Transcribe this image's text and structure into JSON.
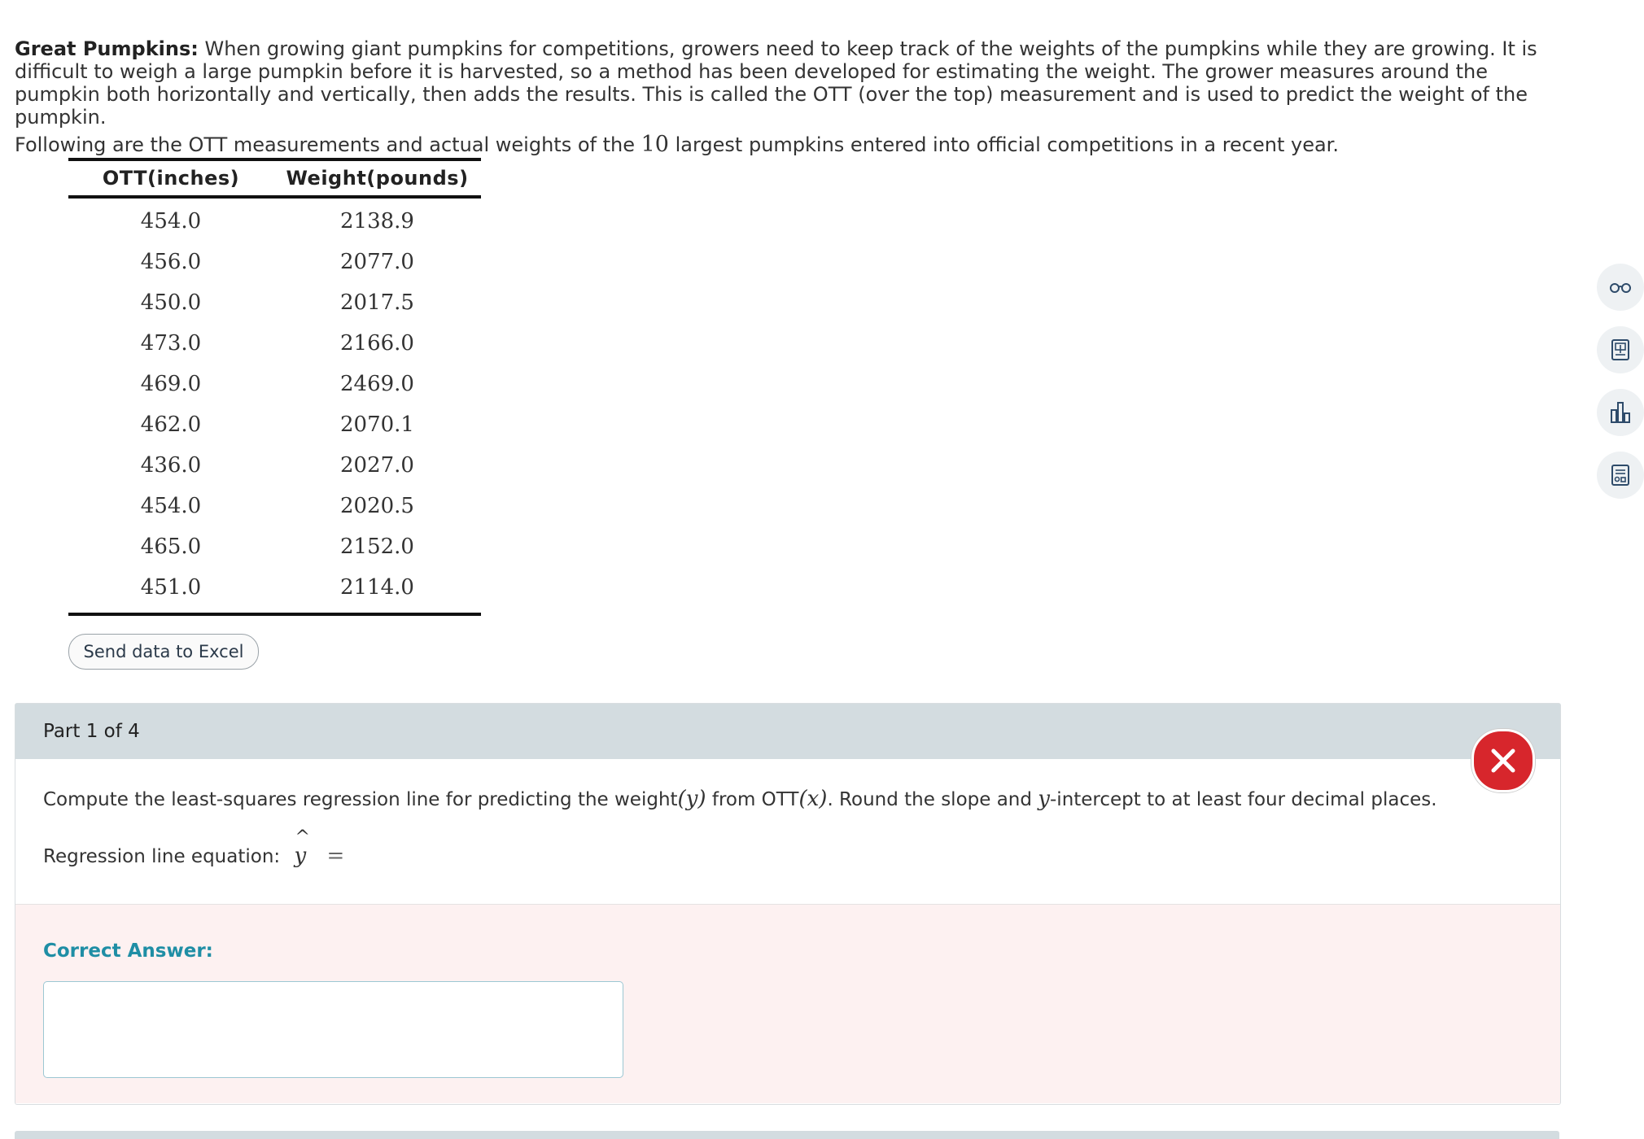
{
  "intro": {
    "title": "Great Pumpkins:",
    "body": " When growing giant pumpkins for competitions, growers need to keep track of the weights of the pumpkins while they are growing. It is difficult to weigh a large pumpkin before it is harvested, so a method has been developed for estimating the weight. The grower measures around the pumpkin both horizontally and vertically, then adds the results. This is called the OTT (over the top) measurement and is used to predict the weight of the pumpkin.",
    "following_pre": "Following are the OTT measurements and actual weights of the ",
    "count": "10",
    "following_post": " largest pumpkins entered into official competitions in a recent year."
  },
  "table": {
    "headers": [
      "OTT(inches)",
      "Weight(pounds)"
    ],
    "rows": [
      [
        "454.0",
        "2138.9"
      ],
      [
        "456.0",
        "2077.0"
      ],
      [
        "450.0",
        "2017.5"
      ],
      [
        "473.0",
        "2166.0"
      ],
      [
        "469.0",
        "2469.0"
      ],
      [
        "462.0",
        "2070.1"
      ],
      [
        "436.0",
        "2027.0"
      ],
      [
        "454.0",
        "2020.5"
      ],
      [
        "465.0",
        "2152.0"
      ],
      [
        "451.0",
        "2114.0"
      ]
    ]
  },
  "excel_button": "Send data to Excel",
  "tools": [
    "glasses-icon",
    "calculator-icon",
    "chart-bars-icon",
    "data-table-icon"
  ],
  "part": {
    "header": "Part 1 of 4",
    "q_pre": "Compute the least-squares regression line for predicting the weight",
    "q_y": "(y)",
    "q_mid": " from OTT",
    "q_x": "(x)",
    "q_mid2": ". Round the slope and ",
    "q_y2": "y",
    "q_post": "-intercept to at least four decimal places.",
    "eq_label": "Regression line equation:",
    "eq_var": "y",
    "eq_sign": "=",
    "correct_label": "Correct Answer:"
  },
  "colors": {
    "header_bg": "#d3dce0",
    "answer_bg": "#fdf1f1",
    "correct_label": "#1f8ea5",
    "wrong_badge": "#d7262c"
  }
}
